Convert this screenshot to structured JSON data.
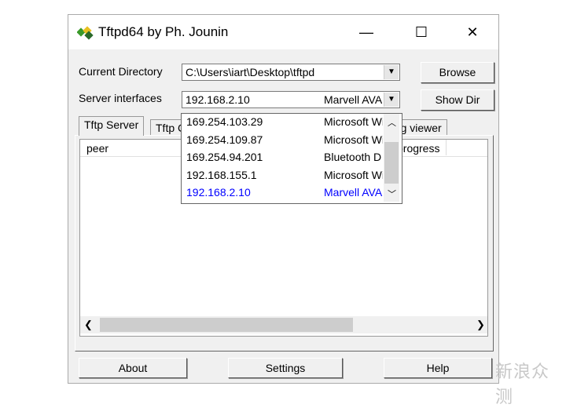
{
  "window": {
    "title": "Tftpd64 by Ph. Jounin",
    "minimize": "—",
    "maximize": "☐",
    "close": "✕",
    "icon": "tftpd-app-icon"
  },
  "form": {
    "current_directory_label": "Current Directory",
    "current_directory_value": "C:\\Users\\iart\\Desktop\\tftpd",
    "server_interfaces_label": "Server interfaces",
    "server_interface_ip": "192.168.2.10",
    "server_interface_desc": "Marvell AVA",
    "browse": "Browse",
    "show_dir": "Show Dir"
  },
  "dropdown": {
    "options": [
      {
        "ip": "169.254.103.29",
        "desc": "Microsoft Wi"
      },
      {
        "ip": "169.254.109.87",
        "desc": "Microsoft Wi"
      },
      {
        "ip": "169.254.94.201",
        "desc": "Bluetooth D"
      },
      {
        "ip": "192.168.155.1",
        "desc": "Microsoft Wi"
      },
      {
        "ip": "192.168.2.10",
        "desc": "Marvell AVA",
        "selected": true
      }
    ],
    "selected_color": "#0000ff"
  },
  "tabs": [
    {
      "label": "Tftp Server",
      "active": true
    },
    {
      "label": "Tftp Client"
    },
    {
      "label": "Log viewer"
    }
  ],
  "table": {
    "columns": [
      "peer",
      "progress"
    ]
  },
  "buttons": {
    "about": "About",
    "settings": "Settings",
    "help": "Help"
  },
  "watermark": "新浪众测"
}
